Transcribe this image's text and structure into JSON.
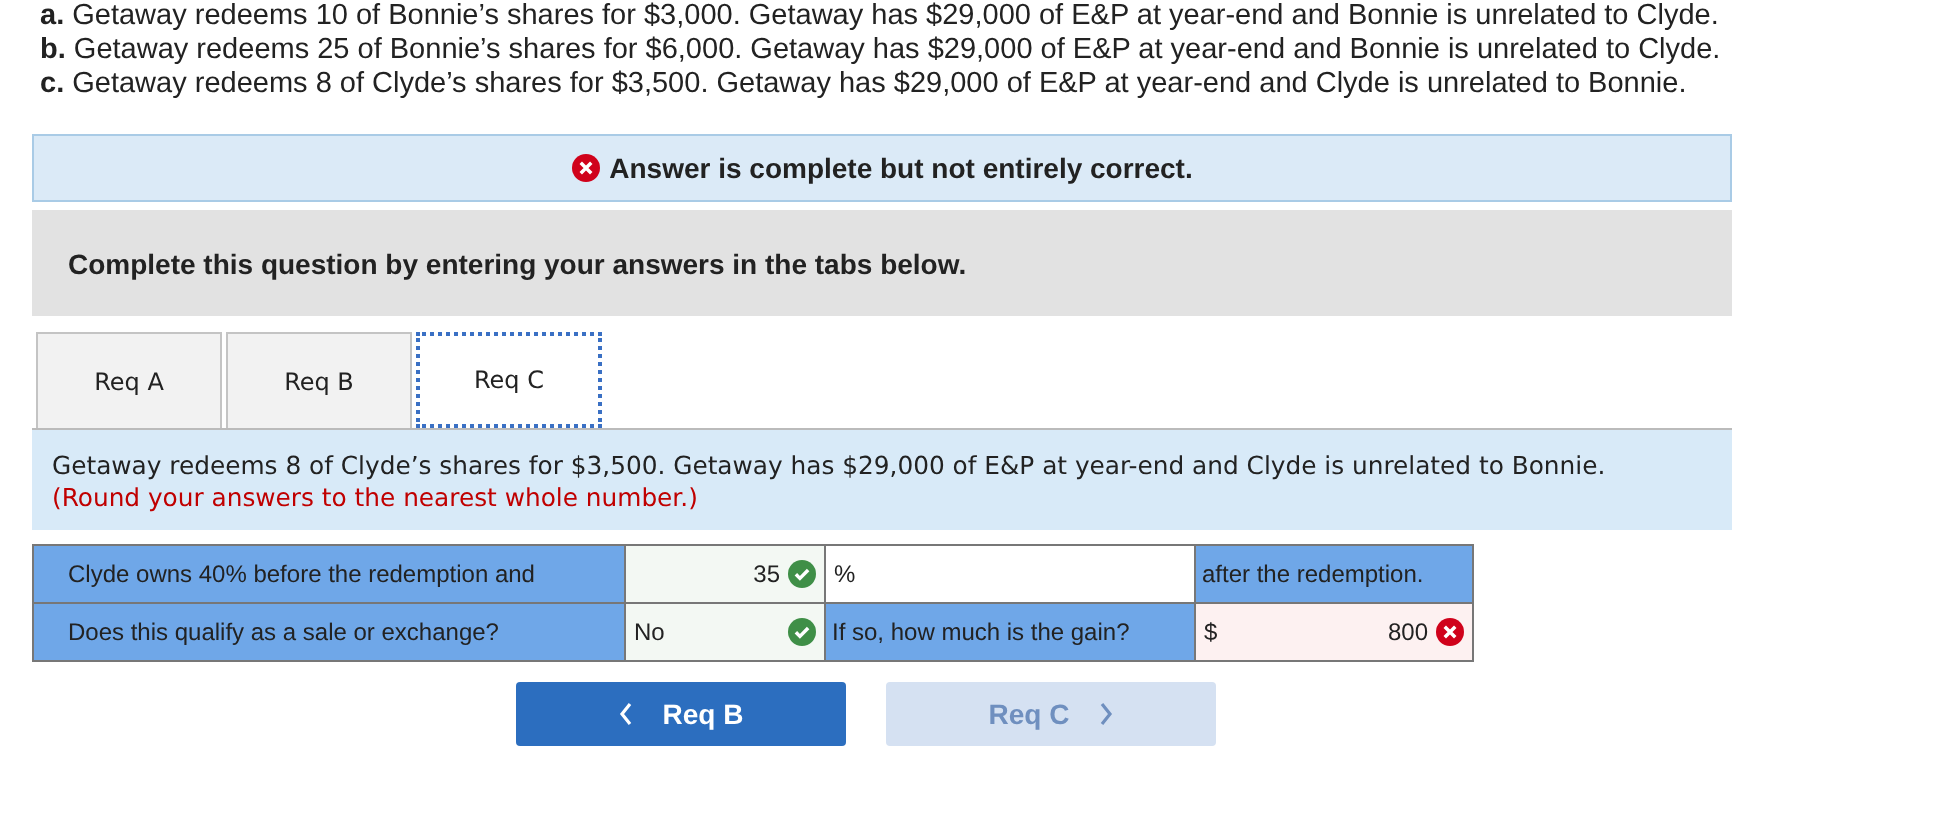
{
  "problem_lines": [
    {
      "letter": "a.",
      "text": "Getaway redeems 10 of Bonnie’s shares for $3,000. Getaway has $29,000 of E&P at year-end and Bonnie is unrelated to Clyde."
    },
    {
      "letter": "b.",
      "text": "Getaway redeems 25 of Bonnie’s shares for $6,000. Getaway has $29,000 of E&P at year-end and Bonnie is unrelated to Clyde."
    },
    {
      "letter": "c.",
      "text": "Getaway redeems 8 of Clyde’s shares for $3,500. Getaway has $29,000 of E&P at year-end and Clyde is unrelated to Bonnie."
    }
  ],
  "result_banner": {
    "correct": false,
    "text": "Answer is complete but not entirely correct."
  },
  "instruction": "Complete this question by entering your answers in the tabs below.",
  "tabs": [
    {
      "label": "Req A",
      "selected": false
    },
    {
      "label": "Req B",
      "selected": false
    },
    {
      "label": "Req C",
      "selected": true
    }
  ],
  "prompt": {
    "text": "Getaway redeems 8 of Clyde’s shares for $3,500. Getaway has $29,000 of E&P at year-end and Clyde is unrelated to Bonnie.",
    "note": "(Round your answers to the nearest whole number.)"
  },
  "table": {
    "rows": [
      {
        "label": "Clyde owns 40% before the redemption and",
        "answer": {
          "value": "35",
          "kind": "number",
          "correct": true
        },
        "unit": "%",
        "label_2": "after the redemption."
      },
      {
        "label": "Does this qualify as a sale or exchange?",
        "answer": {
          "value": "No",
          "kind": "choice",
          "correct": true
        },
        "label_2": "If so, how much is the gain?",
        "prefix": "$",
        "answer_2": {
          "value": "800",
          "kind": "number",
          "correct": false
        }
      }
    ]
  },
  "nav": [
    {
      "label": "Req B",
      "kind": "prev",
      "disabled": false
    },
    {
      "label": "Req C",
      "kind": "next",
      "disabled": true
    }
  ]
}
